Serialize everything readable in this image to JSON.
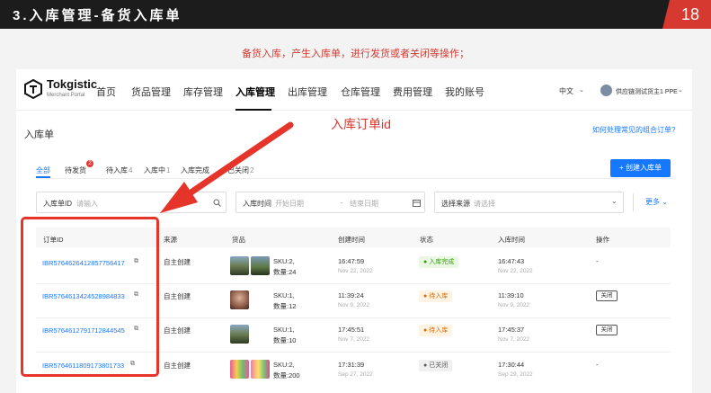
{
  "slide": {
    "title": "3.入库管理-备货入库单",
    "page_number": "18",
    "caption": "备货入库，产生入库单，进行发货或者关闭等操作；",
    "annotation": "入库订单id"
  },
  "nav": {
    "brand": "Tokgistic",
    "brand_sub": "Merchant Portal",
    "menu": [
      "首页",
      "货品管理",
      "库存管理",
      "入库管理",
      "出库管理",
      "仓库管理",
      "费用管理",
      "我的账号"
    ],
    "active_menu": "入库管理",
    "language": "中文",
    "user": "供应链测试货主1 PPE"
  },
  "page": {
    "title": "入库单",
    "help_link": "如何处理常见的组合订单?"
  },
  "tabs": [
    {
      "label": "全部",
      "count": ""
    },
    {
      "label": "待发货",
      "count": "2"
    },
    {
      "label": "待入库",
      "count": "4"
    },
    {
      "label": "入库中",
      "count": "1"
    },
    {
      "label": "入库完成",
      "count": ""
    },
    {
      "label": "已关闭",
      "count": "2"
    }
  ],
  "create_button": "+ 创建入库单",
  "filters": {
    "order_id_label": "入库单ID",
    "order_id_placeholder": "请输入",
    "time_label": "入库时间",
    "start_placeholder": "开始日期",
    "range_sep": "-",
    "end_placeholder": "结束日期",
    "source_label": "选择来源",
    "source_placeholder": "请选择",
    "more": "更多"
  },
  "table": {
    "headers": [
      "订单ID",
      "来源",
      "货品",
      "创建时间",
      "状态",
      "入库时间",
      "操作"
    ],
    "rows": [
      {
        "id": "IBR5764626412857756417",
        "source": "自主创建",
        "sku": "SKU:2,",
        "qty": "数量:24",
        "created_time": "16:47:59",
        "created_date": "Nov 22, 2022",
        "status": "入库完成",
        "status_type": "success",
        "inbound_time": "16:47:43",
        "inbound_date": "Nov 22, 2022",
        "action": "-",
        "thumbs": [
          "landscape",
          "landscape"
        ]
      },
      {
        "id": "IBR5764613424528984833",
        "source": "自主创建",
        "sku": "SKU:1,",
        "qty": "数量:12",
        "created_time": "11:39:24",
        "created_date": "Nov 9, 2022",
        "status": "待入库",
        "status_type": "warning",
        "inbound_time": "11:39:10",
        "inbound_date": "Nov 9, 2022",
        "action": "关闭",
        "thumbs": [
          "portrait"
        ]
      },
      {
        "id": "IBR5764612791712844545",
        "source": "自主创建",
        "sku": "SKU:1,",
        "qty": "数量:10",
        "created_time": "17:45:51",
        "created_date": "Nov 7, 2022",
        "status": "待入库",
        "status_type": "warning",
        "inbound_time": "17:45:37",
        "inbound_date": "Nov 7, 2022",
        "action": "关闭",
        "thumbs": [
          "landscape"
        ]
      },
      {
        "id": "IBR5764611809173801733",
        "source": "自主创建",
        "sku": "SKU:2,",
        "qty": "数量:200",
        "created_time": "17:31:39",
        "created_date": "Sep 27, 2022",
        "status": "已关闭",
        "status_type": "closed",
        "inbound_time": "17:30:44",
        "inbound_date": "Sep 29, 2022",
        "action": "-",
        "thumbs": [
          "colorful",
          "colorful"
        ]
      }
    ]
  },
  "colors": {
    "accent": "#1677ff",
    "slide_red": "#d6392f",
    "highlight_box": "#e5352b",
    "success": "#52c41a",
    "warning": "#fa8c16",
    "closed": "#8c8c8c"
  }
}
